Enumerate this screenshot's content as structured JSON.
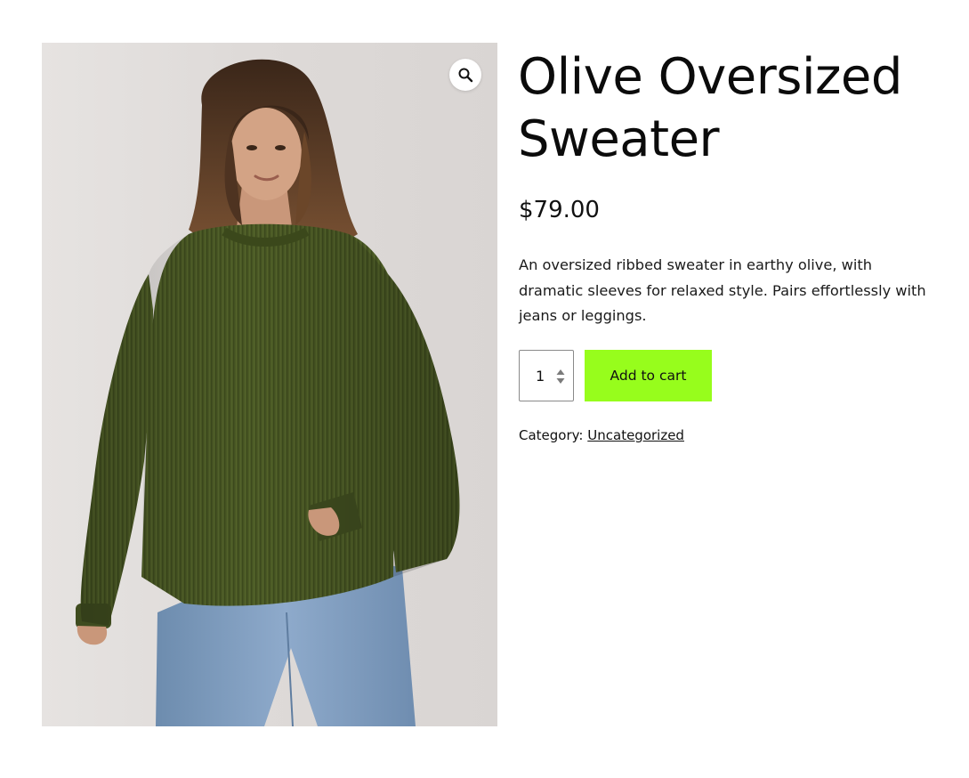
{
  "product": {
    "title": "Olive Oversized Sweater",
    "price": "$79.00",
    "description": "An oversized ribbed sweater in earthy olive, with dramatic sleeves for relaxed style. Pairs effortlessly with jeans or leggings.",
    "quantity": "1",
    "add_to_cart_label": "Add to cart",
    "category_label": "Category:",
    "category_value": "Uncategorized"
  },
  "gallery": {
    "zoom_icon": "magnifier-icon"
  },
  "colors": {
    "add_to_cart_bg": "#97fd1c",
    "sweater": "#4b5a25",
    "jeans": "#7f9cba",
    "background": "#dedad8"
  }
}
